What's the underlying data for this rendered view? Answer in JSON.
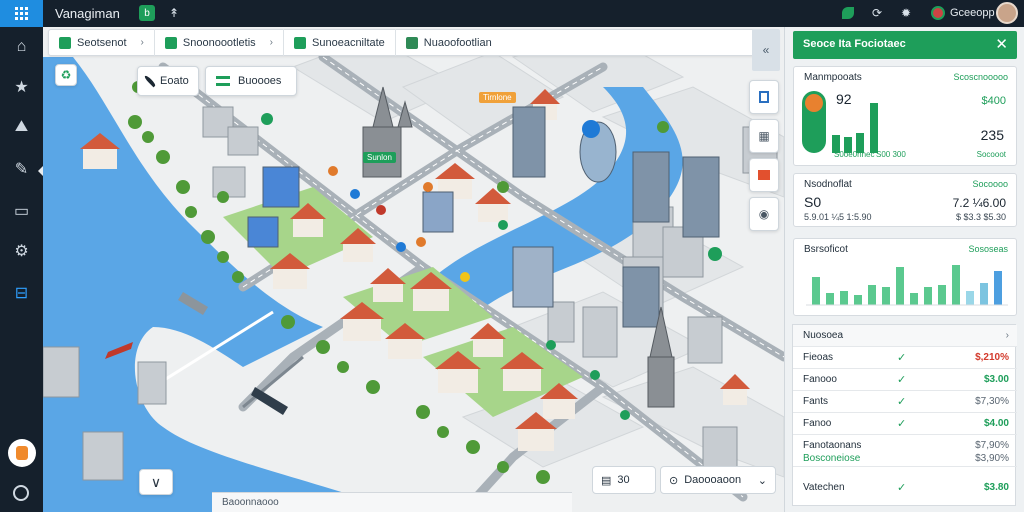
{
  "topbar": {
    "app_title": "Vanagiman",
    "user_name": "Gceeopp",
    "icons": [
      "grid-icon",
      "badge-icon",
      "cursor-icon",
      "leaf-icon",
      "refresh-icon",
      "gear-icon",
      "notification-icon"
    ]
  },
  "rail": {
    "items": [
      "home-icon",
      "star-icon",
      "layers-icon",
      "tag-icon",
      "folder-icon",
      "settings-icon",
      "map-icon"
    ]
  },
  "tabs": {
    "items": [
      {
        "label": "Seotsenot"
      },
      {
        "label": "Snoonoootletis"
      },
      {
        "label": "Sunoeacniltate"
      },
      {
        "label": "Nuaoofootlian"
      }
    ]
  },
  "map": {
    "chips": [
      {
        "label": "Eoato"
      },
      {
        "label": "Buoooes"
      }
    ],
    "labels": [
      {
        "text": "Tirnlone",
        "color": "orange"
      },
      {
        "text": "Sunlon",
        "color": "green"
      }
    ],
    "bottom_search": "Daoooaoon",
    "bottom_count": "30",
    "status": "Baoonnaooo"
  },
  "panel": {
    "header": "Seoce Ita Fociotaec",
    "card1": {
      "title": "Manmpooats",
      "right_label": "Scoscnooooo",
      "value_a": "92",
      "value_b": "$400",
      "value_c": "235",
      "footer_a": "S0oe0nnec",
      "footer_b": "S00 300",
      "footer_c": "Socooot"
    },
    "card2": {
      "title": "Nsodnoflat",
      "right_label": "Socoooo",
      "value_a": "S0",
      "value_b": "7.2 ¼6.00",
      "sub_a": "5.9.01 ¼5 1:5.90",
      "sub_b": "$ $3.3 $5.30"
    },
    "card3": {
      "title": "Bsrsoficot",
      "right_label": "Sososeas",
      "bar_color": "#3fbf7f"
    },
    "table": {
      "title": "Nuosoea",
      "rows": [
        {
          "name": "Fieoas",
          "value": "$,210%",
          "status": "red"
        },
        {
          "name": "Fanooo",
          "value": "$3.00",
          "status": "green"
        },
        {
          "name": "Fants",
          "value": "$7,30%",
          "status": "gray"
        },
        {
          "name": "Fanoo",
          "value": "$4.00",
          "status": "green"
        },
        {
          "name": "Fanotaonans",
          "value": "$7,90%",
          "status": "gray"
        },
        {
          "name": "Bosconeiose",
          "value": "$3,90%",
          "status": "green"
        },
        {
          "name": "Vatechen",
          "value": "$3.80",
          "status": "green"
        }
      ]
    }
  },
  "colors": {
    "accent": "#1e9e5a",
    "topbar": "#15202c",
    "water": "#4d9fe0",
    "roof": "#d25a3b"
  }
}
